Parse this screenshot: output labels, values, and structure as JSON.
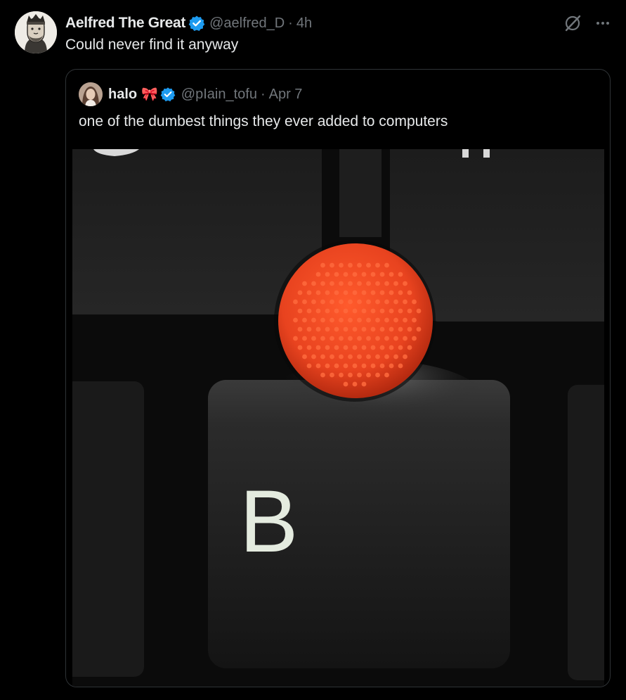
{
  "tweet": {
    "author_name": "Aelfred The Great",
    "handle": "@aelfred_D",
    "separator": "·",
    "time": "4h",
    "text": "Could never find it anyway"
  },
  "quoted": {
    "author_name": "halo",
    "emoji": "🎀",
    "handle": "@pIain_tofu",
    "separator": "·",
    "time": "Apr 7",
    "text": "one of the dumbest things they ever added to computers",
    "media_key_letter": "B"
  },
  "colors": {
    "background": "#000000",
    "text": "#e7e9ea",
    "muted": "#71767b",
    "verified": "#1d9bf0",
    "border": "#2f3336",
    "trackpoint": "#e8431f"
  },
  "icons": [
    "verified-badge-icon",
    "grok-icon",
    "more-options-icon"
  ]
}
